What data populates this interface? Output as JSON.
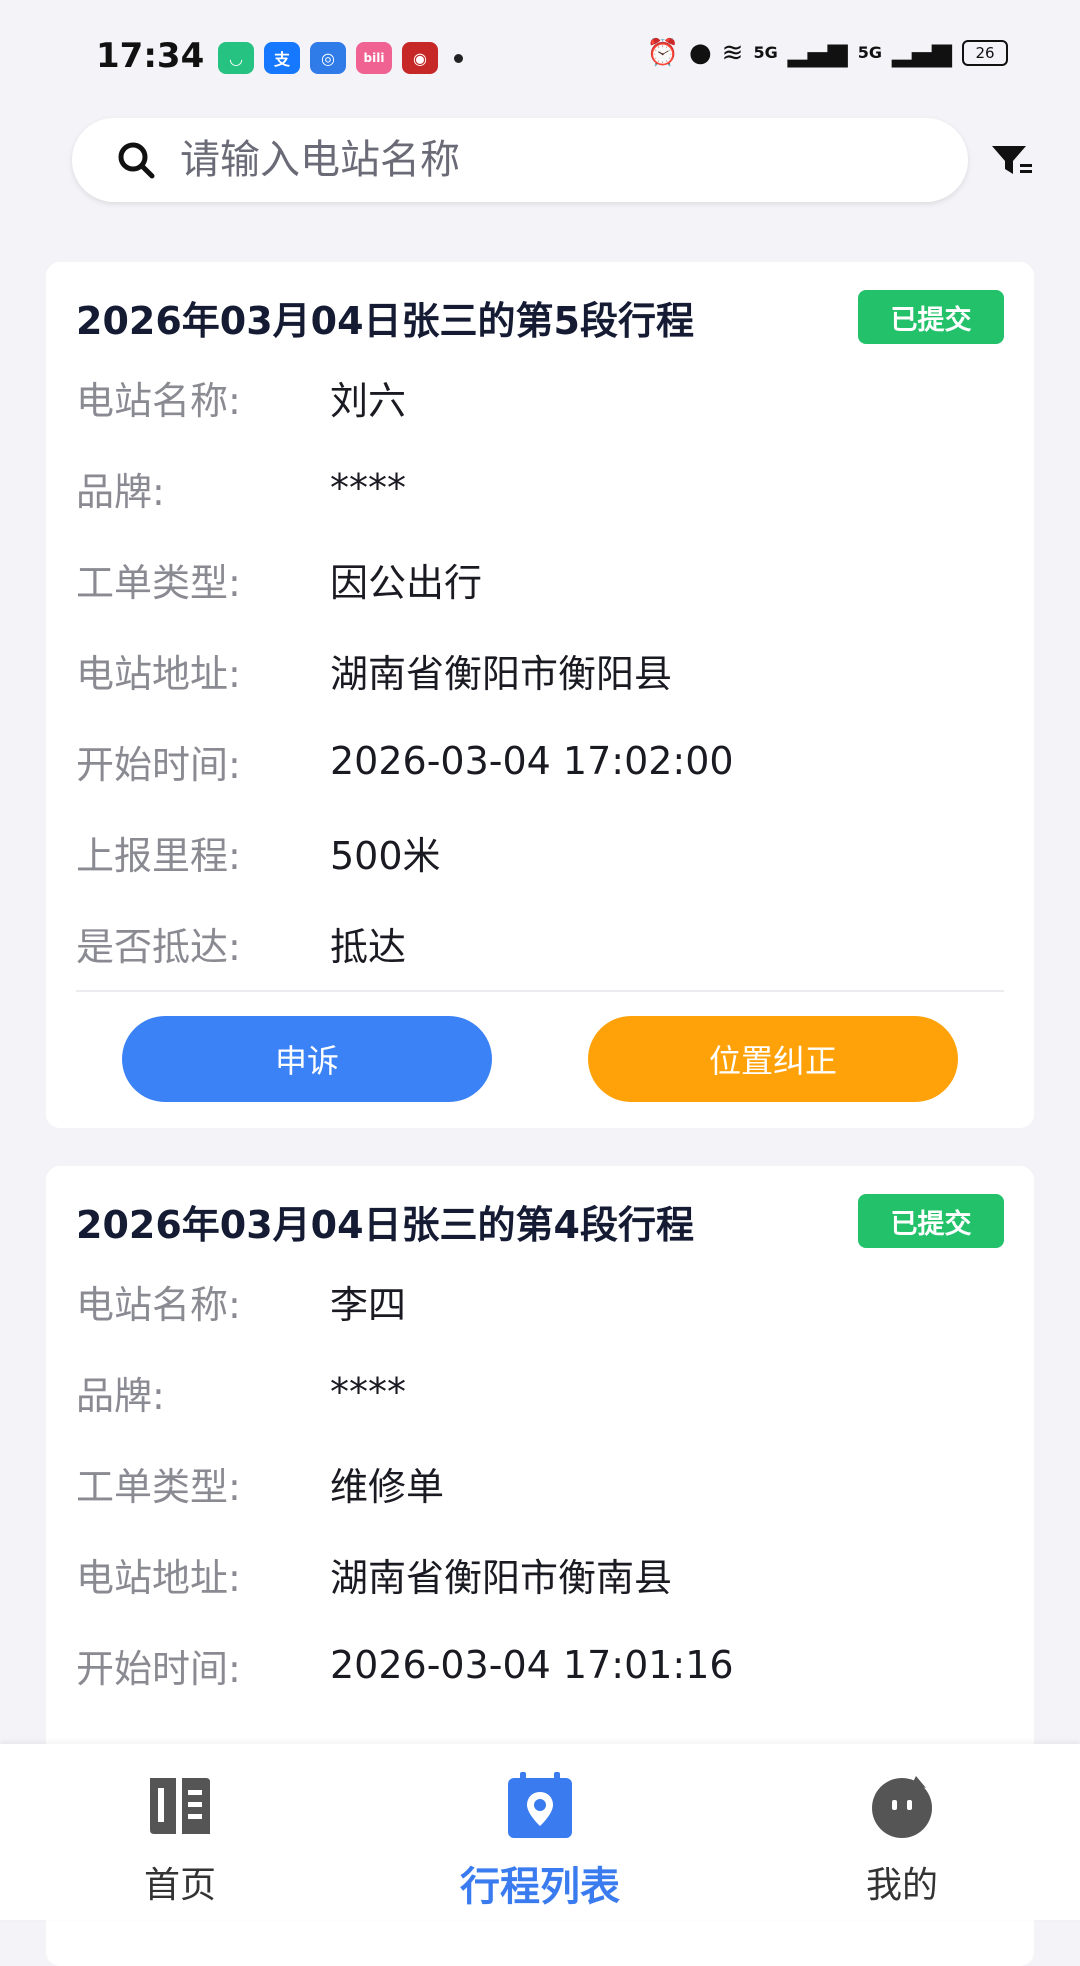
{
  "status_bar": {
    "time": "17:34",
    "apps": [
      {
        "icon": "mi-app-icon",
        "label": "",
        "color": "#26c281"
      },
      {
        "icon": "alipay-icon",
        "label": "支",
        "color": "#1677ff"
      },
      {
        "icon": "app-icon-3",
        "label": "",
        "color": "#2f7be8"
      },
      {
        "icon": "bilibili-icon",
        "label": "bili",
        "color": "#f06292"
      },
      {
        "icon": "app-icon-5",
        "label": "",
        "color": "#c62828"
      }
    ],
    "signal_1": "5G",
    "signal_2": "5G",
    "battery": "26"
  },
  "search": {
    "placeholder": "请输入电站名称"
  },
  "trips": [
    {
      "title": "2026年03月04日张三的第5段行程",
      "status": "已提交",
      "fields": [
        {
          "label": "电站名称:",
          "value": "刘六"
        },
        {
          "label": "品牌:",
          "value": "****"
        },
        {
          "label": "工单类型:",
          "value": "因公出行"
        },
        {
          "label": "电站地址:",
          "value": "湖南省衡阳市衡阳县"
        },
        {
          "label": "开始时间:",
          "value": "2026-03-04 17:02:00"
        },
        {
          "label": "上报里程:",
          "value": "500米"
        },
        {
          "label": "是否抵达:",
          "value": "抵达"
        }
      ],
      "actions": {
        "appeal": "申诉",
        "correct": "位置纠正"
      }
    },
    {
      "title": "2026年03月04日张三的第4段行程",
      "status": "已提交",
      "fields": [
        {
          "label": "电站名称:",
          "value": "李四"
        },
        {
          "label": "品牌:",
          "value": "****"
        },
        {
          "label": "工单类型:",
          "value": "维修单"
        },
        {
          "label": "电站地址:",
          "value": "湖南省衡阳市衡南县"
        },
        {
          "label": "开始时间:",
          "value": "2026-03-04 17:01:16"
        }
      ]
    }
  ],
  "bottom_nav": {
    "home": "首页",
    "trips": "行程列表",
    "mine": "我的",
    "active": "trips"
  },
  "colors": {
    "primary": "#3a7bf0",
    "submitted_badge": "#23c26a",
    "appeal_button": "#3b82f6",
    "correct_button": "#ffa20a"
  }
}
